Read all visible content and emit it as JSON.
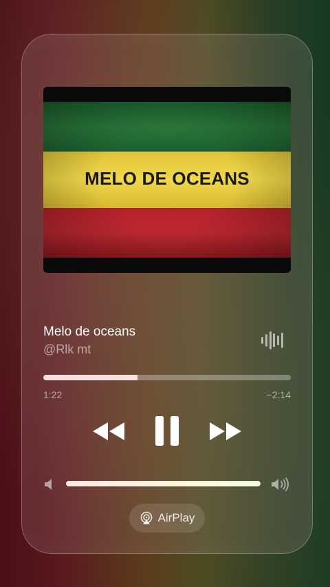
{
  "artwork": {
    "title": "MELO DE OCEANS"
  },
  "track": {
    "title": "Melo de oceans",
    "artist": "@Rlk mt",
    "elapsed": "1:22",
    "remaining": "−2:14",
    "progress": 0.38
  },
  "controls": {
    "rewind_icon": "rewind-icon",
    "pause_icon": "pause-icon",
    "forward_icon": "fast-forward-icon",
    "waveform_icon": "waveform-icon"
  },
  "volume": {
    "level": 1.0,
    "low_icon": "speaker-low-icon",
    "high_icon": "speaker-high-icon"
  },
  "airplay": {
    "label": "AirPlay",
    "icon": "airplay-icon"
  },
  "colors": {
    "flag_green": "#2a7a3c",
    "flag_yellow": "#f0d84a",
    "flag_red": "#c42a32"
  }
}
